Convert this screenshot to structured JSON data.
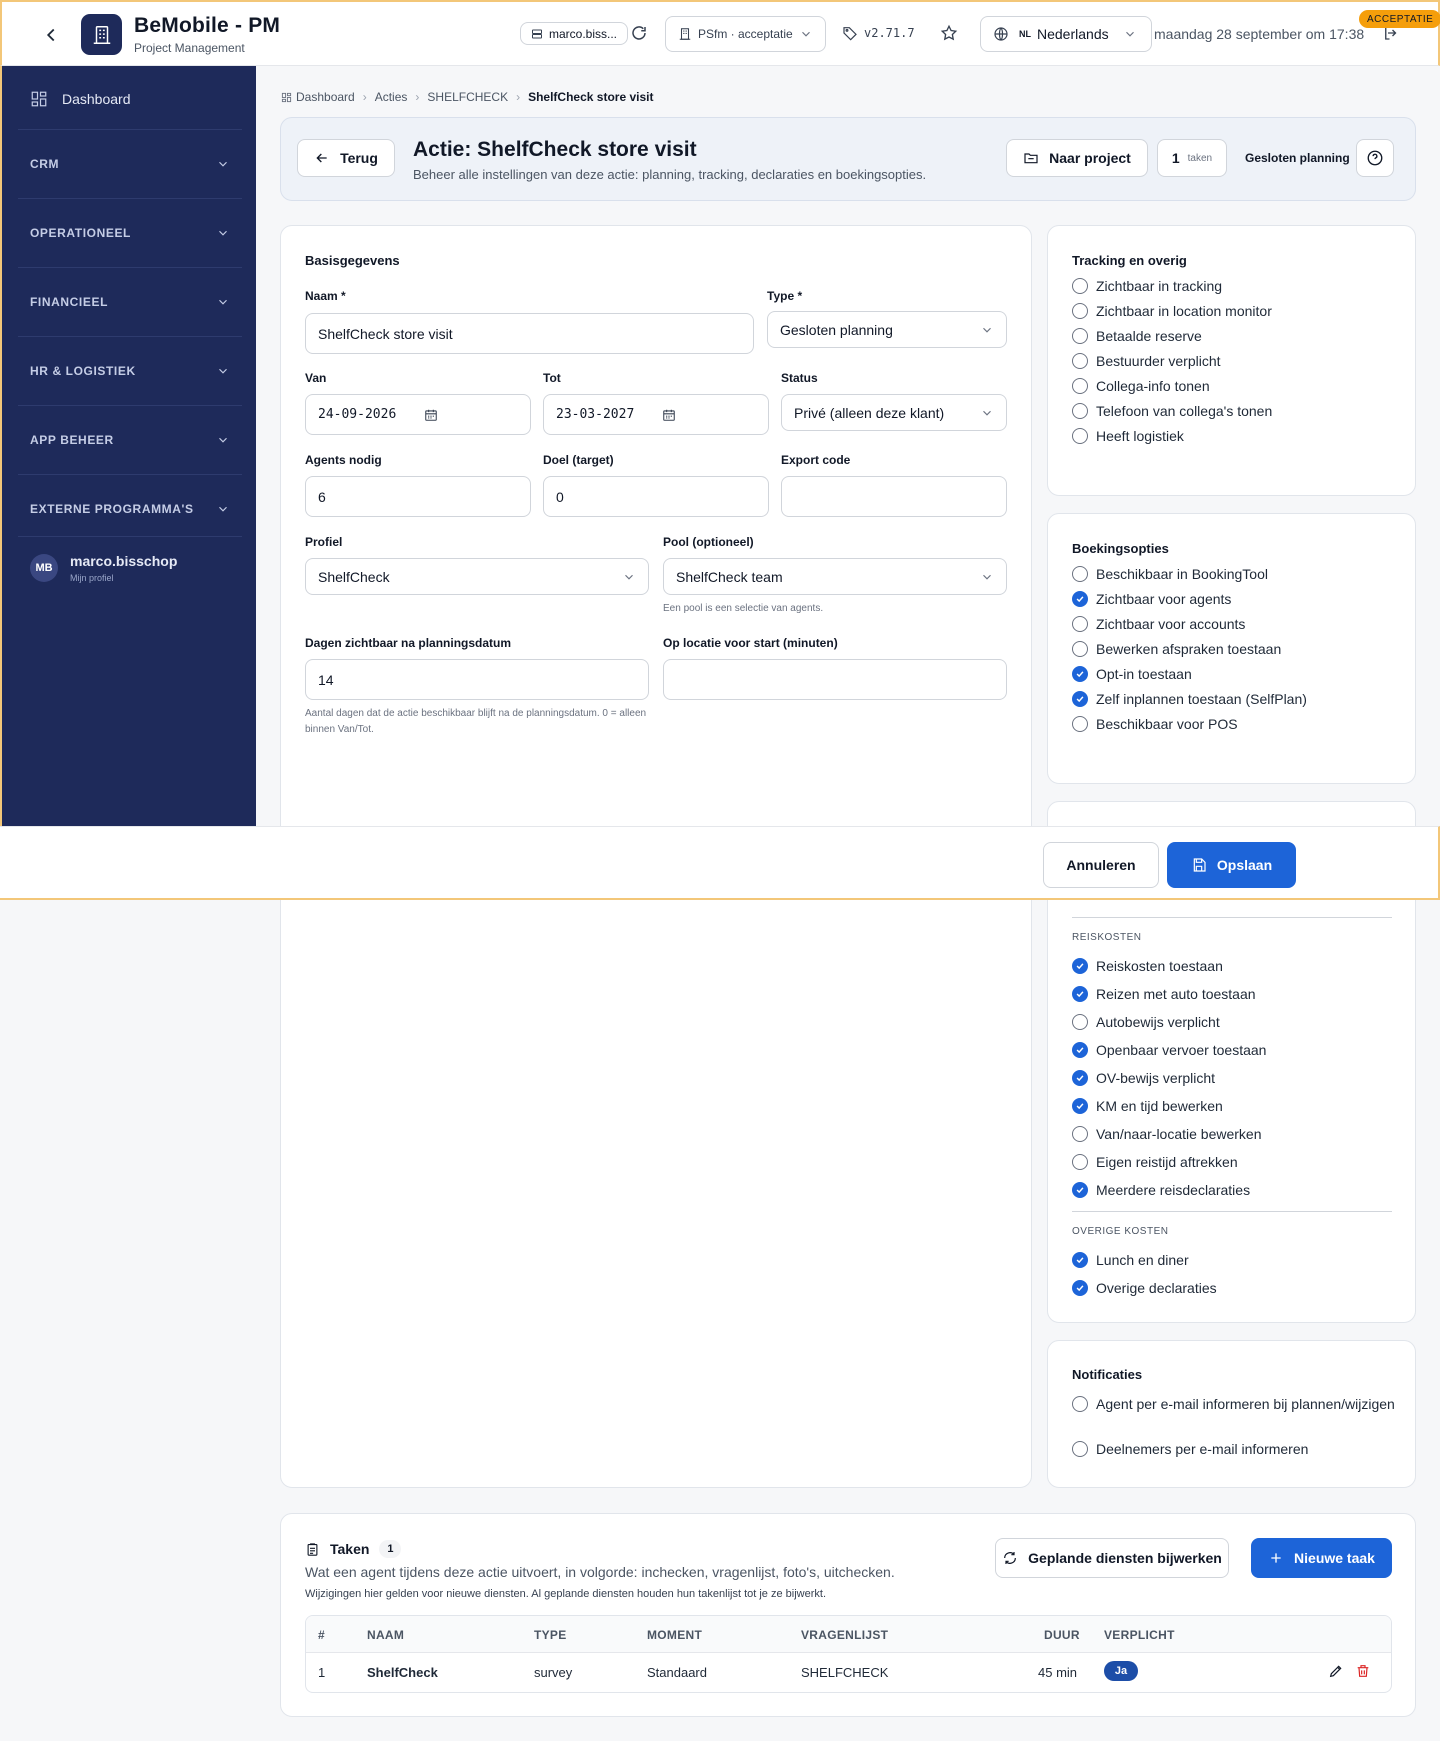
{
  "header": {
    "app_title": "BeMobile - PM",
    "app_subtitle": "Project Management",
    "user_pill": "marco.biss...",
    "environment": "PSfm · acceptatie",
    "version": "v2.71.7",
    "language_code": "NL",
    "language": "Nederlands",
    "datetime": "maandag 28 september om 17:38",
    "env_badge": "ACCEPTATIE"
  },
  "sidebar": {
    "dashboard": "Dashboard",
    "sections": [
      "CRM",
      "OPERATIONEEL",
      "FINANCIEEL",
      "HR & LOGISTIEK",
      "APP BEHEER",
      "EXTERNE PROGRAMMA'S"
    ],
    "profile": {
      "initials": "MB",
      "name": "marco.bisschop",
      "subtitle": "Mijn profiel"
    }
  },
  "breadcrumb": [
    "Dashboard",
    "Acties",
    "SHELFCHECK",
    "ShelfCheck store visit"
  ],
  "hero": {
    "back": "Terug",
    "title": "Actie: ShelfCheck store visit",
    "subtitle": "Beheer alle instellingen van deze actie: planning, tracking, declaraties en boekingsopties.",
    "project_button": "Naar project",
    "tasks_count": "1",
    "tasks_label": "taken",
    "planning_type": "Gesloten planning"
  },
  "basis": {
    "title": "Basisgegevens",
    "naam_label": "Naam *",
    "naam_value": "ShelfCheck store visit",
    "type_label": "Type *",
    "type_value": "Gesloten planning",
    "van_label": "Van",
    "van_value": "24-09-2026",
    "tot_label": "Tot",
    "tot_value": "23-03-2027",
    "status_label": "Status",
    "status_value": "Privé (alleen deze klant)",
    "agents_label": "Agents nodig",
    "agents_value": "6",
    "doel_label": "Doel (target)",
    "doel_value": "0",
    "export_label": "Export code",
    "export_value": "",
    "profiel_label": "Profiel",
    "profiel_value": "ShelfCheck",
    "pool_label": "Pool (optioneel)",
    "pool_value": "ShelfCheck team",
    "pool_hint": "Een pool is een selectie van agents.",
    "dagen_label": "Dagen zichtbaar na planningsdatum",
    "dagen_value": "14",
    "dagen_hint": "Aantal dagen dat de actie beschikbaar blijft na de planningsdatum. 0 = alleen binnen Van/Tot.",
    "oplocatie_label": "Op locatie voor start (minuten)",
    "oplocatie_value": ""
  },
  "tracking": {
    "title": "Tracking en overig",
    "options": [
      {
        "label": "Zichtbaar in tracking",
        "checked": false
      },
      {
        "label": "Zichtbaar in location monitor",
        "checked": false
      },
      {
        "label": "Betaalde reserve",
        "checked": false
      },
      {
        "label": "Bestuurder verplicht",
        "checked": false
      },
      {
        "label": "Collega-info tonen",
        "checked": false
      },
      {
        "label": "Telefoon van collega's tonen",
        "checked": false
      },
      {
        "label": "Heeft logistiek",
        "checked": false
      }
    ]
  },
  "booking": {
    "title": "Boekingsopties",
    "options": [
      {
        "label": "Beschikbaar in BookingTool",
        "checked": false
      },
      {
        "label": "Zichtbaar voor agents",
        "checked": true
      },
      {
        "label": "Zichtbaar voor accounts",
        "checked": false
      },
      {
        "label": "Bewerken afspraken toestaan",
        "checked": false
      },
      {
        "label": "Opt-in toestaan",
        "checked": true
      },
      {
        "label": "Zelf inplannen toestaan (SelfPlan)",
        "checked": true
      },
      {
        "label": "Beschikbaar voor POS",
        "checked": false
      }
    ]
  },
  "costs": {
    "travel_header": "REISKOSTEN",
    "travel": [
      {
        "label": "Reiskosten toestaan",
        "checked": true
      },
      {
        "label": "Reizen met auto toestaan",
        "checked": true
      },
      {
        "label": "Autobewijs verplicht",
        "checked": false
      },
      {
        "label": "Openbaar vervoer toestaan",
        "checked": true
      },
      {
        "label": "OV-bewijs verplicht",
        "checked": true
      },
      {
        "label": "KM en tijd bewerken",
        "checked": true
      },
      {
        "label": "Van/naar-locatie bewerken",
        "checked": false
      },
      {
        "label": "Eigen reistijd aftrekken",
        "checked": false
      },
      {
        "label": "Meerdere reisdeclaraties",
        "checked": true
      }
    ],
    "other_header": "OVERIGE KOSTEN",
    "other": [
      {
        "label": "Lunch en diner",
        "checked": true
      },
      {
        "label": "Overige declaraties",
        "checked": true
      }
    ]
  },
  "notifications": {
    "title": "Notificaties",
    "options": [
      {
        "label": "Agent per e-mail informeren bij plannen/wijzigen",
        "checked": false
      },
      {
        "label": "Deelnemers per e-mail informeren",
        "checked": false
      }
    ]
  },
  "footer": {
    "cancel": "Annuleren",
    "save": "Opslaan"
  },
  "tasks": {
    "title": "Taken",
    "count": "1",
    "subtitle": "Wat een agent tijdens deze actie uitvoert, in volgorde: inchecken, vragenlijst, foto's, uitchecken.",
    "note": "Wijzigingen hier gelden voor nieuwe diensten. Al geplande diensten houden hun takenlijst tot je ze bijwerkt.",
    "resync_button": "Geplande diensten bijwerken",
    "new_button": "Nieuwe taak",
    "columns": [
      "#",
      "NAAM",
      "TYPE",
      "MOMENT",
      "VRAGENLIJST",
      "DUUR",
      "VERPLICHT"
    ],
    "rows": [
      {
        "nr": "1",
        "naam": "ShelfCheck",
        "type": "survey",
        "moment": "Standaard",
        "vragenlijst": "SHELFCHECK",
        "duur": "45 min",
        "verplicht": "Ja"
      }
    ]
  },
  "colors": {
    "primary": "#1d64d8",
    "sidebar": "#1e2a5a",
    "accent_border": "#f3c779",
    "badge": "#f59e0b"
  }
}
